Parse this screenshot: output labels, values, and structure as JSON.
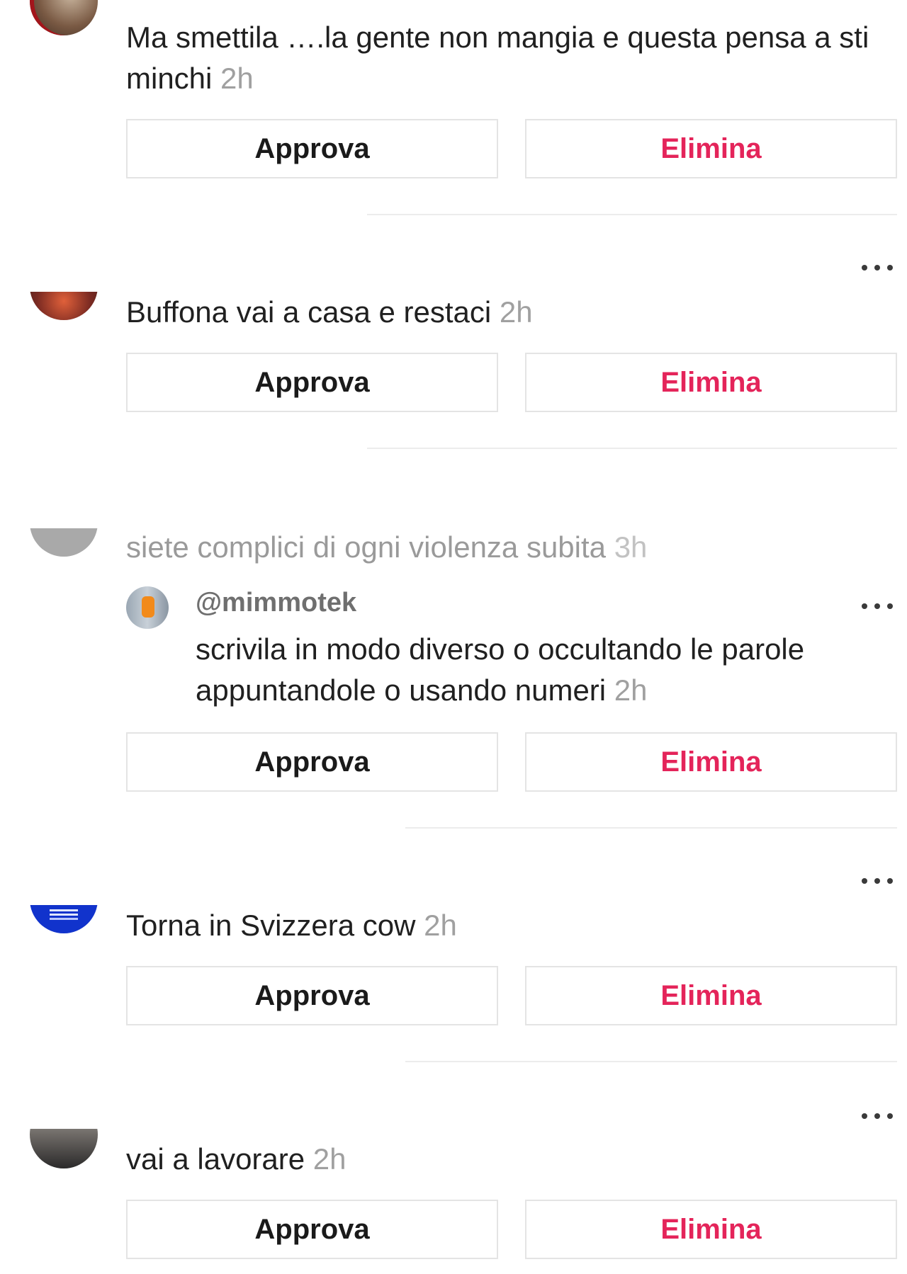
{
  "comments": [
    {
      "text": "Ma smettila ….la gente non mangia e questa pensa a sti minchi",
      "time": "2h"
    },
    {
      "text": "Buffona vai a casa e restaci",
      "time": "2h"
    },
    {
      "text": "siete complici di ogni violenza subita",
      "time": "3h",
      "reply": {
        "handle": "@mimmotek",
        "text": "scrivila in modo diverso o occultando le parole appuntandole o usando numeri",
        "time": "2h"
      }
    },
    {
      "text": "Torna in Svizzera cow",
      "time": "2h"
    },
    {
      "text": "vai a lavorare",
      "time": "2h"
    }
  ],
  "actions": {
    "approve_label": "Approva",
    "delete_label": "Elimina"
  },
  "colors": {
    "delete": "#e4245a",
    "muted_text": "#9a9a9a",
    "border": "#e4e4e4"
  },
  "icons": {
    "more": "more-options-icon"
  }
}
